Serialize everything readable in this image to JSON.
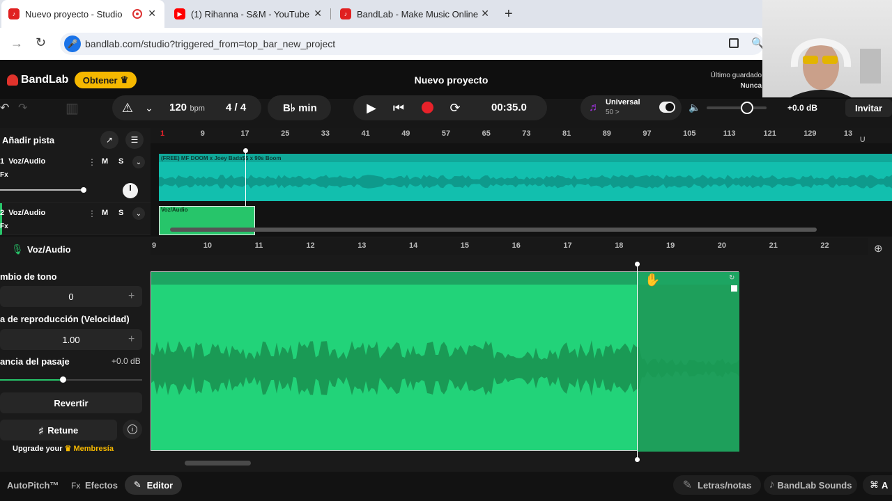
{
  "browser": {
    "tabs": [
      {
        "title": "Nuevo proyecto - Studio"
      },
      {
        "title": "(1) Rihanna - S&M - YouTube"
      },
      {
        "title": "BandLab - Make Music Online"
      }
    ],
    "url": "bandlab.com/studio?triggered_from=top_bar_new_project"
  },
  "header": {
    "logo": "BandLab",
    "obtener": "Obtener",
    "project_title": "Nuevo proyecto",
    "saved_line1": "Último guardado",
    "saved_line2": "Nunca"
  },
  "toolbar": {
    "bpm_value": "120",
    "bpm_unit": "bpm",
    "time_signature": "4 / 4",
    "key": "B♭ min",
    "time": "00:35.0",
    "preset_name": "Universal",
    "preset_sub": "50 >",
    "volume": "+0.0 dB",
    "master_volume_level": 0.7,
    "invite": "Invitar"
  },
  "tracks": {
    "add_track": "Añadir pista",
    "ruler_ticks": [
      "1",
      "9",
      "17",
      "25",
      "33",
      "41",
      "49",
      "57",
      "65",
      "73",
      "81",
      "89",
      "97",
      "105",
      "113",
      "121",
      "129",
      "13"
    ],
    "items": [
      {
        "number": "1",
        "name": "Voz/Audio",
        "fx": "Fx",
        "mute": "M",
        "solo": "S",
        "clip_label": "(FREE) MF DOOM x Joey Bada$$ x 90s Boom"
      },
      {
        "number": "2",
        "name": "Voz/Audio",
        "fx": "Fx",
        "mute": "M",
        "solo": "S",
        "clip_label": "Voz/Audio"
      }
    ]
  },
  "editor": {
    "track_name": "Voz/Audio",
    "ruler_ticks": [
      "9",
      "10",
      "11",
      "12",
      "13",
      "14",
      "15",
      "16",
      "17",
      "18",
      "19",
      "20",
      "21",
      "22"
    ],
    "pitch_label": "mbio de tono",
    "pitch_value": "0",
    "speed_label": "a de reproducción (Velocidad)",
    "speed_value": "1.00",
    "gain_label": "ancia del pasaje",
    "gain_value": "+0.0 dB",
    "revert": "Revertir",
    "retune": "Retune",
    "upgrade": "Upgrade your",
    "membership": "Membresía"
  },
  "bottom": {
    "autopitch": "AutoPitch™",
    "effects": "Efectos",
    "fx_prefix": "Fx",
    "editor": "Editor",
    "lyrics": "Letras/notas",
    "sounds": "BandLab Sounds",
    "cut": "A"
  },
  "colors": {
    "accent_yellow": "#f5b800",
    "track1_clip": "#12bfae",
    "track2_clip": "#27c56a",
    "record": "#e8222a"
  }
}
